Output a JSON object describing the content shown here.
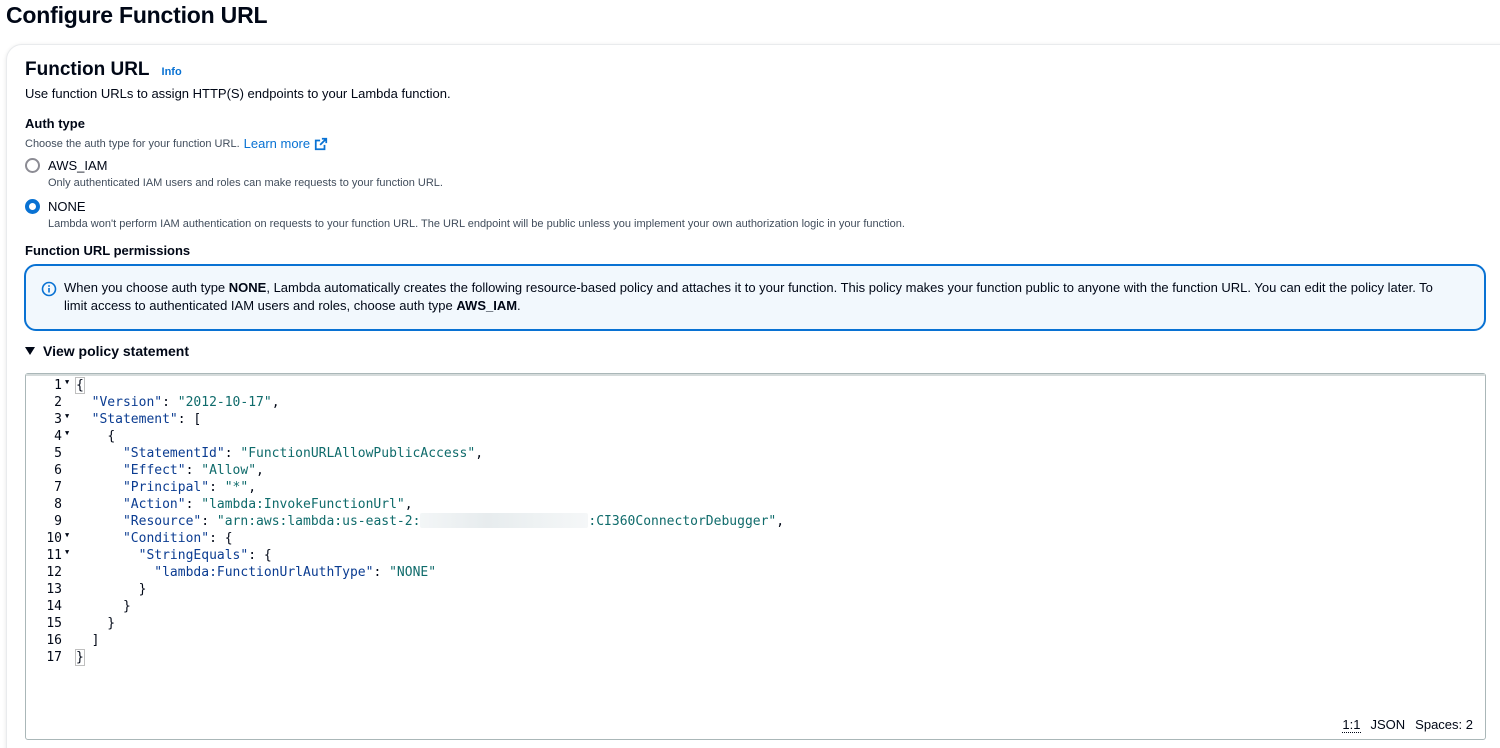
{
  "page": {
    "title": "Configure Function URL"
  },
  "section": {
    "title": "Function URL",
    "info_label": "Info",
    "description": "Use function URLs to assign HTTP(S) endpoints to your Lambda function."
  },
  "auth_type": {
    "label": "Auth type",
    "description": "Choose the auth type for your function URL.",
    "learn_more": "Learn more",
    "options": [
      {
        "label": "AWS_IAM",
        "description": "Only authenticated IAM users and roles can make requests to your function URL.",
        "selected": false
      },
      {
        "label": "NONE",
        "description": "Lambda won't perform IAM authentication on requests to your function URL. The URL endpoint will be public unless you implement your own authorization logic in your function.",
        "selected": true
      }
    ]
  },
  "permissions": {
    "label": "Function URL permissions",
    "alert": {
      "part1": "When you choose auth type ",
      "bold1": "NONE",
      "part2": ", Lambda automatically creates the following resource-based policy and attaches it to your function. This policy makes your function public to anyone with the function URL. You can edit the policy later. To limit access to authenticated IAM users and roles, choose auth type ",
      "bold2": "AWS_IAM",
      "part3": "."
    }
  },
  "policy": {
    "toggle_label": "View policy statement",
    "lines": {
      "l1": "{",
      "l2k": "\"Version\"",
      "l2v": "\"2012-10-17\"",
      "l3k": "\"Statement\"",
      "l4": "{",
      "l5k": "\"StatementId\"",
      "l5v": "\"FunctionURLAllowPublicAccess\"",
      "l6k": "\"Effect\"",
      "l6v": "\"Allow\"",
      "l7k": "\"Principal\"",
      "l7v": "\"*\"",
      "l8k": "\"Action\"",
      "l8v": "\"lambda:InvokeFunctionUrl\"",
      "l9k": "\"Resource\"",
      "l9v1": "\"arn:aws:lambda:us-east-2:",
      "l9v2": ":CI360ConnectorDebugger\"",
      "l10k": "\"Condition\"",
      "l11k": "\"StringEquals\"",
      "l12k": "\"lambda:FunctionUrlAuthType\"",
      "l12v": "\"NONE\"",
      "l17": "}"
    },
    "status": {
      "position": "1:1",
      "language": "JSON",
      "indent": "Spaces: 2"
    }
  }
}
